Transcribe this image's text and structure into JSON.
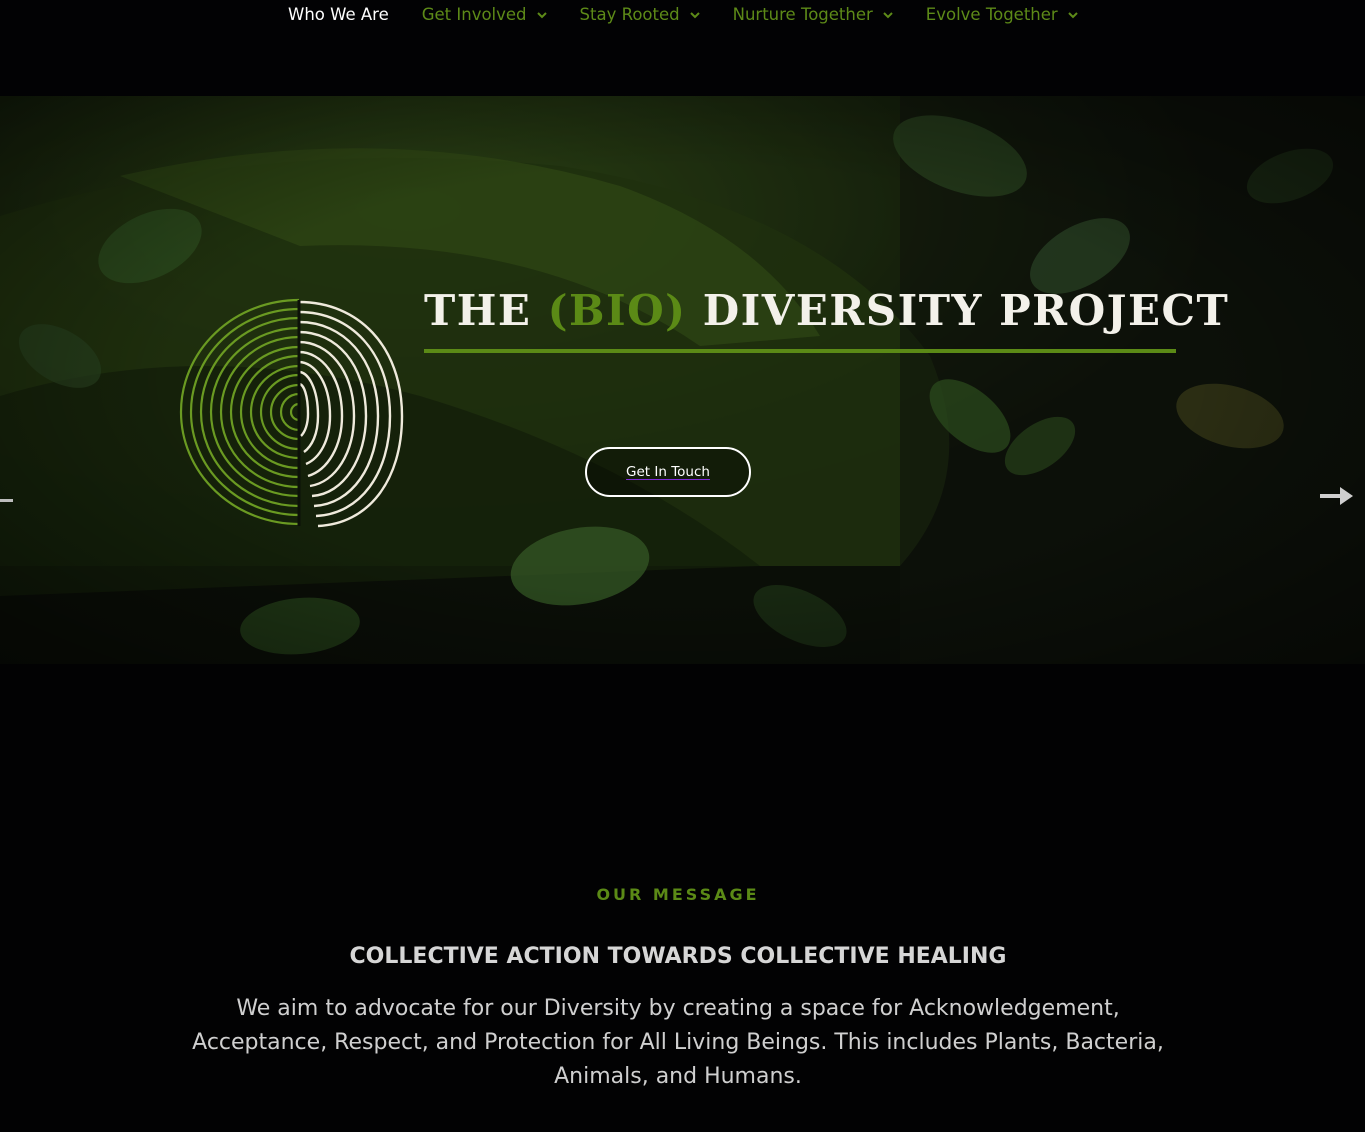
{
  "nav": {
    "items": [
      {
        "label": "Who We Are",
        "active": true,
        "has_dropdown": false
      },
      {
        "label": "Get Involved",
        "active": false,
        "has_dropdown": true
      },
      {
        "label": "Stay Rooted",
        "active": false,
        "has_dropdown": true
      },
      {
        "label": "Nurture Together",
        "active": false,
        "has_dropdown": true
      },
      {
        "label": "Evolve Together",
        "active": false,
        "has_dropdown": true
      }
    ]
  },
  "hero": {
    "title_the": "THE",
    "title_bio": "(BIO)",
    "title_rest": "DIVERSITY PROJECT",
    "cta_label": "Get In Touch",
    "prev_icon": "arrow-left-icon",
    "next_icon": "arrow-right-icon"
  },
  "message": {
    "kicker": "OUR MESSAGE",
    "headline": "COLLECTIVE ACTION TOWARDS COLLECTIVE HEALING",
    "body": "We aim to advocate for our Diversity by creating a space for Acknowledgement, Acceptance, Respect, and Protection for All Living Beings. This includes Plants, Bacteria, Animals, and Humans."
  },
  "colors": {
    "accent_green": "#5b8a16",
    "nav_active": "#ffffff",
    "background": "#020203",
    "link_underline": "#7d2bd8"
  }
}
